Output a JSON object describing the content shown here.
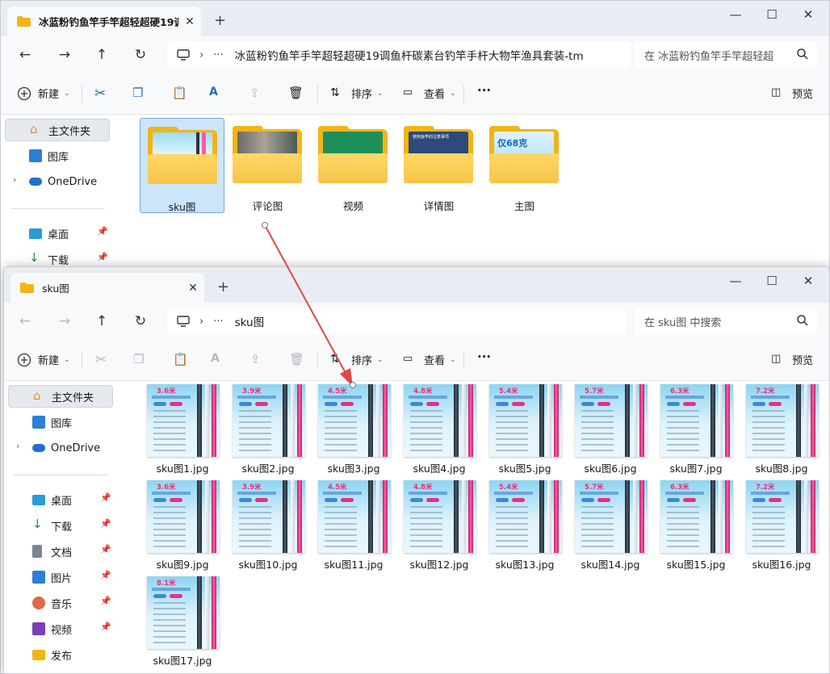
{
  "colors": {
    "accent": "#f2b417",
    "arrow": "#e04848",
    "selection": "#cce5fb"
  },
  "window_main": {
    "tab_title": "冰蓝粉钓鱼竿手竿超轻超硬19调",
    "address_path": "冰蓝粉钓鱼竿手竿超轻超硬19调鱼杆碳素台钓竿手杆大物竿渔具套装-tm",
    "search_placeholder": "在 冰蓝粉钓鱼竿手竿超轻超",
    "toolbar": {
      "new": "新建",
      "sort": "排序",
      "view": "查看",
      "more": "···",
      "preview": "预览"
    },
    "sidebar": [
      {
        "label": "主文件夹",
        "icon": "home-icon"
      },
      {
        "label": "图库",
        "icon": "gallery-icon"
      },
      {
        "label": "OneDrive",
        "icon": "cloud-icon"
      },
      {
        "label": "桌面",
        "icon": "desktop-icon"
      },
      {
        "label": "下载",
        "icon": "download-icon"
      }
    ],
    "folders": [
      {
        "name": "sku图",
        "selected": true
      },
      {
        "name": "评论图",
        "selected": false
      },
      {
        "name": "视频",
        "selected": false
      },
      {
        "name": "详情图",
        "selected": false
      },
      {
        "name": "主图",
        "selected": false
      }
    ],
    "folder_preview_texts": {
      "detail": "使用鱼竿的注意事项",
      "main_price": "仅68克"
    }
  },
  "window_sku": {
    "tab_title": "sku图",
    "address_path": "sku图",
    "search_placeholder": "在 sku图 中搜索",
    "toolbar": {
      "new": "新建",
      "sort": "排序",
      "view": "查看",
      "more": "···",
      "preview": "预览"
    },
    "sidebar": [
      {
        "label": "主文件夹",
        "icon": "home-icon"
      },
      {
        "label": "图库",
        "icon": "gallery-icon"
      },
      {
        "label": "OneDrive",
        "icon": "cloud-icon"
      },
      {
        "label": "桌面",
        "icon": "desktop-icon"
      },
      {
        "label": "下载",
        "icon": "download-icon"
      },
      {
        "label": "文档",
        "icon": "document-icon"
      },
      {
        "label": "图片",
        "icon": "pictures-icon"
      },
      {
        "label": "音乐",
        "icon": "music-icon"
      },
      {
        "label": "视频",
        "icon": "video-icon"
      },
      {
        "label": "发布",
        "icon": "folder-icon"
      }
    ],
    "files": [
      {
        "name": "sku图1.jpg",
        "length": "3.6米"
      },
      {
        "name": "sku图2.jpg",
        "length": "3.9米"
      },
      {
        "name": "sku图3.jpg",
        "length": "4.5米"
      },
      {
        "name": "sku图4.jpg",
        "length": "4.8米"
      },
      {
        "name": "sku图5.jpg",
        "length": "5.4米"
      },
      {
        "name": "sku图6.jpg",
        "length": "5.7米"
      },
      {
        "name": "sku图7.jpg",
        "length": "6.3米"
      },
      {
        "name": "sku图8.jpg",
        "length": "7.2米"
      },
      {
        "name": "sku图9.jpg",
        "length": "3.6米"
      },
      {
        "name": "sku图10.jpg",
        "length": "3.9米"
      },
      {
        "name": "sku图11.jpg",
        "length": "4.5米"
      },
      {
        "name": "sku图12.jpg",
        "length": "4.8米"
      },
      {
        "name": "sku图13.jpg",
        "length": "5.4米"
      },
      {
        "name": "sku图14.jpg",
        "length": "5.7米"
      },
      {
        "name": "sku图15.jpg",
        "length": "6.3米"
      },
      {
        "name": "sku图16.jpg",
        "length": "7.2米"
      },
      {
        "name": "sku图17.jpg",
        "length": "8.1米"
      }
    ]
  }
}
